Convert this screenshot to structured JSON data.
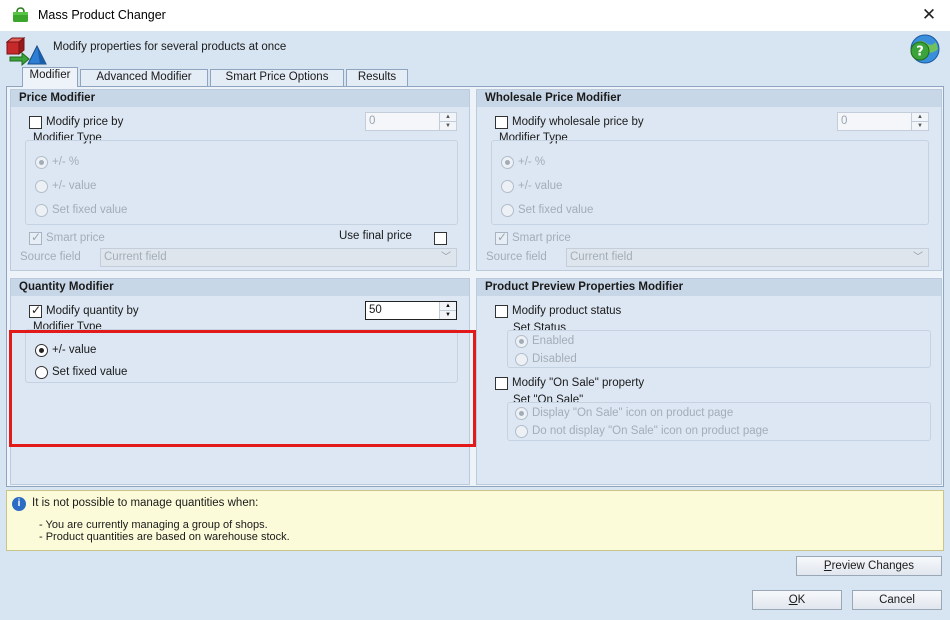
{
  "window": {
    "title": "Mass Product Changer",
    "close_glyph": "✕",
    "header_text": "Modify properties for several products at once"
  },
  "tabs": [
    {
      "label": "Modifier",
      "active": true
    },
    {
      "label": "Advanced Modifier",
      "active": false
    },
    {
      "label": "Smart Price Options",
      "active": false
    },
    {
      "label": "Results",
      "active": false
    }
  ],
  "price_modifier": {
    "header": "Price Modifier",
    "modify_label": "Modify price by",
    "modify_checked": false,
    "value": "0",
    "group_label": "Modifier Type",
    "options": [
      "+/- %",
      "+/- value",
      "Set fixed value"
    ],
    "selected_option": "+/- %",
    "smart_price_label": "Smart price",
    "smart_price_checked": true,
    "use_final_label": "Use final price",
    "use_final_checked": false,
    "source_field_label": "Source field",
    "source_field_value": "Current field"
  },
  "wholesale_modifier": {
    "header": "Wholesale Price Modifier",
    "modify_label": "Modify wholesale price by",
    "modify_checked": false,
    "value": "0",
    "group_label": "Modifier Type",
    "options": [
      "+/- %",
      "+/- value",
      "Set fixed value"
    ],
    "selected_option": "+/- %",
    "smart_price_label": "Smart price",
    "smart_price_checked": true,
    "source_field_label": "Source field",
    "source_field_value": "Current field"
  },
  "quantity_modifier": {
    "header": "Quantity Modifier",
    "modify_label": "Modify quantity by",
    "modify_checked": true,
    "value": "50",
    "group_label": "Modifier Type",
    "options": [
      "+/- value",
      "Set fixed value"
    ],
    "selected_option": "+/- value"
  },
  "preview_modifier": {
    "header": "Product Preview Properties Modifier",
    "status_label": "Modify product status",
    "status_checked": false,
    "status_group_label": "Set Status",
    "status_options": [
      "Enabled",
      "Disabled"
    ],
    "status_selected": "Enabled",
    "onsale_label": "Modify \"On Sale\" property",
    "onsale_checked": false,
    "onsale_group_label": "Set \"On Sale\"",
    "onsale_options": [
      "Display \"On Sale\" icon on product page",
      "Do not display \"On Sale\" icon on product page"
    ],
    "onsale_selected": "Display \"On Sale\" icon on product page"
  },
  "info": {
    "icon": "i",
    "title": "It is not possible to manage quantities when:",
    "lines": [
      "- You are currently managing a group of shops.",
      "- Product quantities are based on warehouse stock."
    ]
  },
  "buttons": {
    "preview_access": "P",
    "preview_rest": "review Changes",
    "ok_access": "O",
    "ok_rest": "K",
    "cancel": "Cancel"
  },
  "colors": {
    "highlight": "#e21a1a",
    "client_bg": "#d7e4f2",
    "info_bg": "#fcfbd9"
  }
}
